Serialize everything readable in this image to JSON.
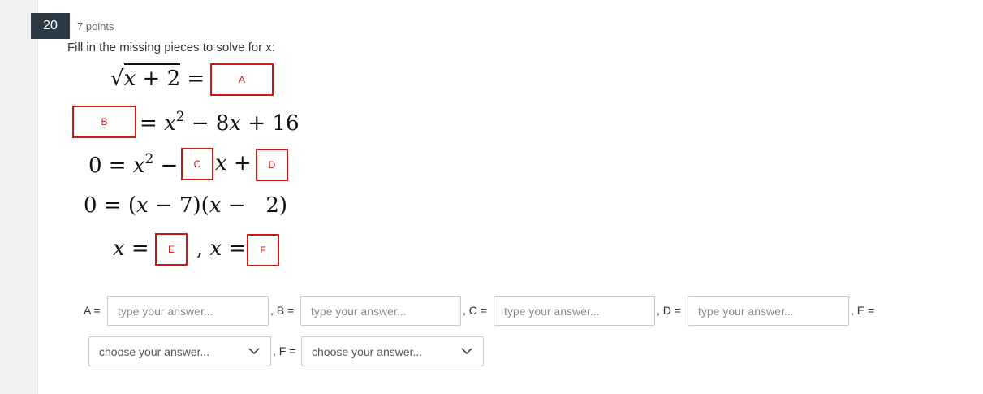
{
  "question": {
    "number": "20",
    "points": "7 points",
    "prompt": "Fill in the missing pieces to solve for x:"
  },
  "equations": {
    "line1": {
      "sqrt_radicand": "x + 2",
      "equals": " ="
    },
    "line2": {
      "rhs": "= x² − 8x + 16"
    },
    "line3": {
      "lhs": "0 = x² −",
      "mid": "x +"
    },
    "line4": {
      "text": "0 = (x − 7)(x −   2)"
    },
    "line5": {
      "lhs": "x =",
      "mid": ", x ="
    }
  },
  "boxes": {
    "a": "A",
    "b": "B",
    "c": "C",
    "d": "D",
    "e": "E",
    "f": "F"
  },
  "answers": {
    "a_label": "A =",
    "b_label": ", B =",
    "c_label": ", C =",
    "d_label": ", D =",
    "e_label": ", E =",
    "f_label": ", F =",
    "text_placeholder": "type your answer...",
    "select_placeholder": "choose your answer..."
  },
  "colors": {
    "badge_bg": "#2d3a43",
    "box_border": "#d11414"
  },
  "icons": {
    "select_chevron": "chevron-down-icon"
  }
}
